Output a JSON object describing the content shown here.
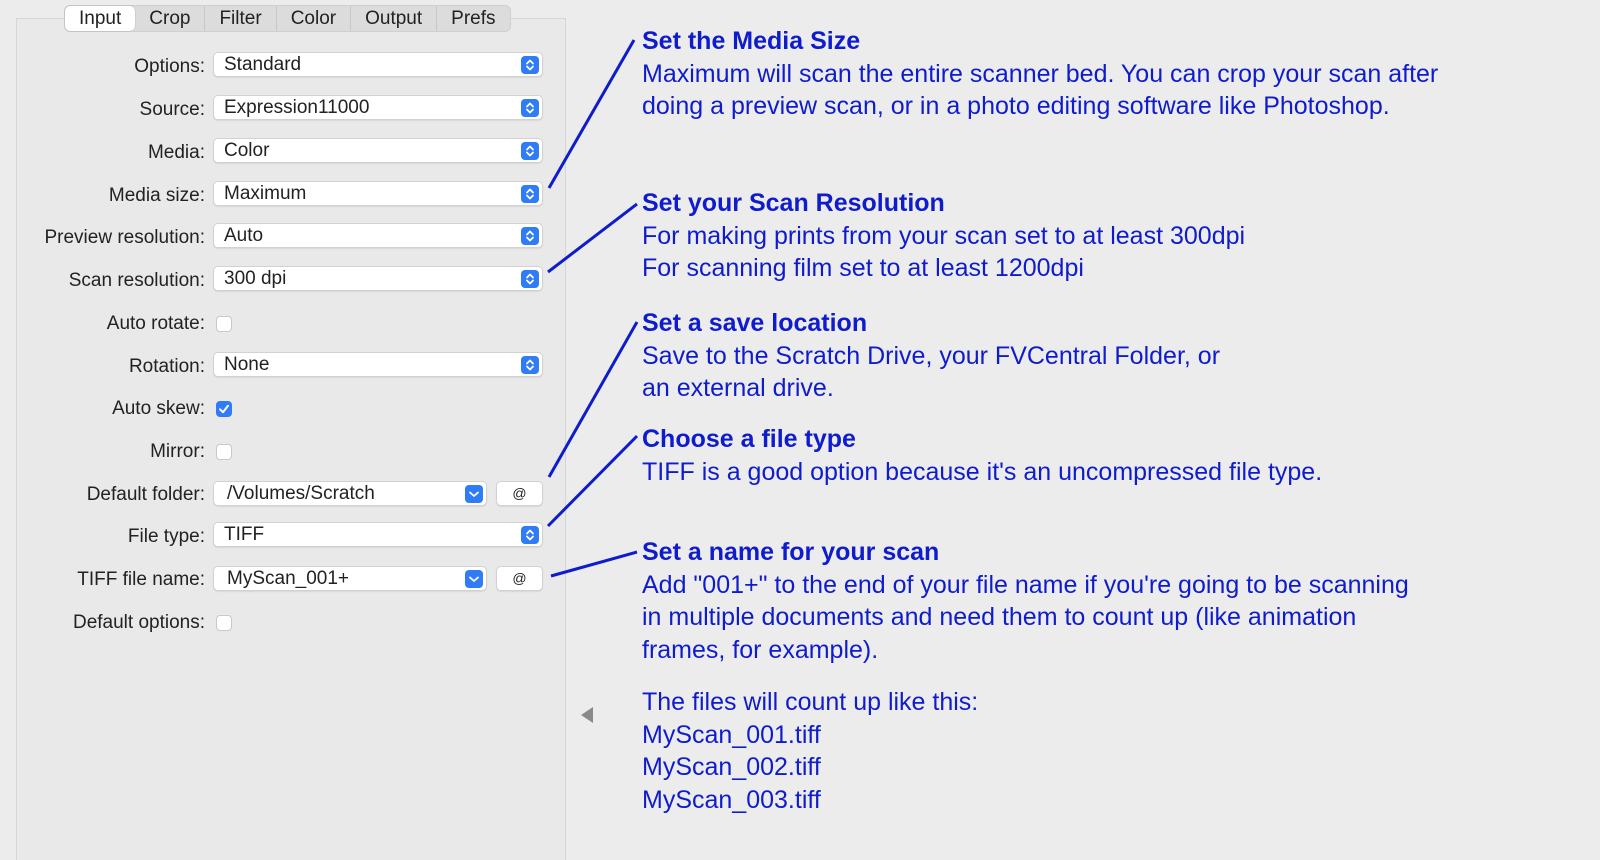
{
  "tabs": [
    "Input",
    "Crop",
    "Filter",
    "Color",
    "Output",
    "Prefs"
  ],
  "settings": {
    "options": {
      "label": "Options:",
      "value": "Standard"
    },
    "source": {
      "label": "Source:",
      "value": "Expression11000"
    },
    "media": {
      "label": "Media:",
      "value": "Color"
    },
    "media_size": {
      "label": "Media size:",
      "value": "Maximum"
    },
    "preview_resolution": {
      "label": "Preview resolution:",
      "value": "Auto"
    },
    "scan_resolution": {
      "label": "Scan resolution:",
      "value": "300 dpi"
    },
    "auto_rotate": {
      "label": "Auto rotate:",
      "checked": false
    },
    "rotation": {
      "label": "Rotation:",
      "value": "None"
    },
    "auto_skew": {
      "label": "Auto skew:",
      "checked": true
    },
    "mirror": {
      "label": "Mirror:",
      "checked": false
    },
    "default_folder": {
      "label": "Default folder:",
      "value": "/Volumes/Scratch",
      "button": "@"
    },
    "file_type": {
      "label": "File type:",
      "value": "TIFF"
    },
    "tiff_file_name": {
      "label": "TIFF file name:",
      "value": "MyScan_001+",
      "button": "@"
    },
    "default_options": {
      "label": "Default options:",
      "checked": false
    }
  },
  "annotations": {
    "media_size": {
      "title": "Set the Media Size",
      "lines": [
        "Maximum will scan the entire scanner bed. You can crop your scan after",
        "doing a preview scan, or in a photo editing software like Photoshop."
      ]
    },
    "resolution": {
      "title": "Set your Scan Resolution",
      "lines": [
        "For making prints from your scan set to at least 300dpi",
        "For scanning film set to at least 1200dpi"
      ]
    },
    "save_location": {
      "title": "Set a save location",
      "lines": [
        "Save to the Scratch Drive, your FVCentral Folder, or",
        "an external drive."
      ]
    },
    "file_type": {
      "title": "Choose a file type",
      "lines": [
        "TIFF is a good option because it's an uncompressed file type."
      ]
    },
    "file_name": {
      "title": "Set a name for your scan",
      "lines": [
        "Add \"001+\" to the end of your file name if you're going to be scanning",
        "in multiple documents and need them to count up (like animation",
        "frames, for example)."
      ]
    },
    "count_up": {
      "lines": [
        "The files will count up like this:",
        "MyScan_001.tiff",
        "MyScan_002.tiff",
        "MyScan_003.tiff"
      ]
    }
  },
  "colors": {
    "annotation": "#0f1ccc",
    "accent": "#2f7cf6"
  }
}
